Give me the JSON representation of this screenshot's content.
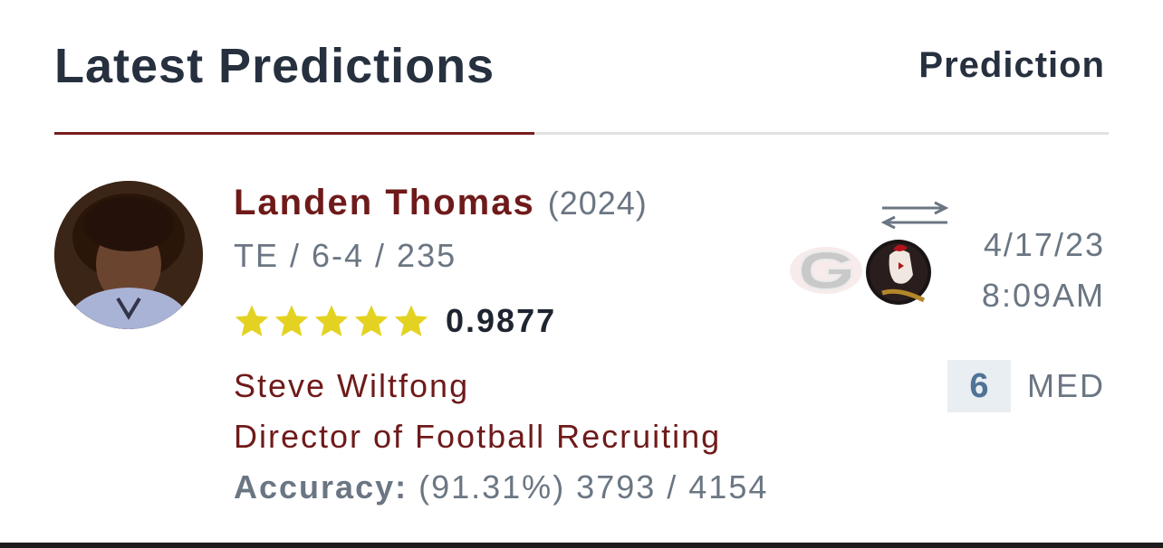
{
  "header": {
    "title": "Latest Predictions",
    "right_label": "Prediction"
  },
  "player": {
    "name": "Landen Thomas",
    "year": "(2024)",
    "details": "TE / 6-4 / 235",
    "stars": 5,
    "rating": "0.9877"
  },
  "analyst": {
    "name": "Steve Wiltfong",
    "role": "Director of Football Recruiting",
    "accuracy_label": "Accuracy:",
    "accuracy_value": "(91.31%) 3793 / 4154"
  },
  "prediction": {
    "from_logo": "georgia-g-logo",
    "to_logo": "florida-state-seminole-logo",
    "swap_icon": "swap-arrows-icon",
    "date": "4/17/23",
    "time": "8:09AM",
    "confidence": "6",
    "confidence_label": "MED"
  },
  "colors": {
    "brand": "#7a1e1e",
    "text_dark": "#26303f",
    "text_muted": "#6b7683",
    "star": "#e4d222"
  }
}
